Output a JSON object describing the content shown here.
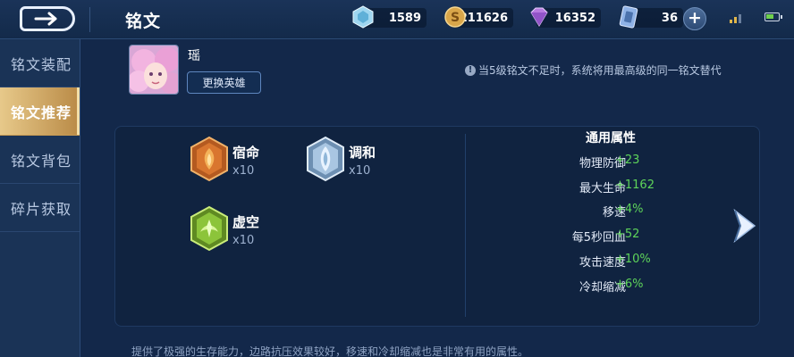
{
  "header": {
    "title": "铭文",
    "resources": [
      {
        "name": "diamond",
        "value": "1589"
      },
      {
        "name": "gold",
        "value": "211626"
      },
      {
        "name": "gem",
        "value": "16352"
      },
      {
        "name": "card",
        "value": "36"
      }
    ]
  },
  "sidebar": {
    "items": [
      {
        "label": "铭文装配",
        "active": false
      },
      {
        "label": "铭文推荐",
        "active": true
      },
      {
        "label": "铭文背包",
        "active": false
      },
      {
        "label": "碎片获取",
        "active": false
      }
    ]
  },
  "hero": {
    "name": "瑶",
    "change_button": "更换英雄"
  },
  "hint": "当5级铭文不足时，系统将用最高级的同一铭文替代",
  "runes": [
    {
      "name": "宿命",
      "count": "x10",
      "color": "#d06a28"
    },
    {
      "name": "调和",
      "count": "x10",
      "color": "#8fb6d8"
    },
    {
      "name": "虚空",
      "count": "x10",
      "color": "#8cc43a"
    }
  ],
  "stats": {
    "title": "通用属性",
    "rows": [
      {
        "label": "物理防御",
        "value": "+23"
      },
      {
        "label": "最大生命",
        "value": "+1162"
      },
      {
        "label": "移速",
        "value": "+4%"
      },
      {
        "label": "每5秒回血",
        "value": "+52"
      },
      {
        "label": "攻击速度",
        "value": "+10%"
      },
      {
        "label": "冷却缩减",
        "value": "+6%"
      }
    ]
  },
  "description": "提供了极强的生存能力，边路抗压效果较好，移速和冷却缩减也是非常有用的属性。",
  "colors": {
    "background": "#13284a",
    "panel": "#102340",
    "active_tab": "#d9b26e",
    "stat_value": "#5ed45a"
  }
}
